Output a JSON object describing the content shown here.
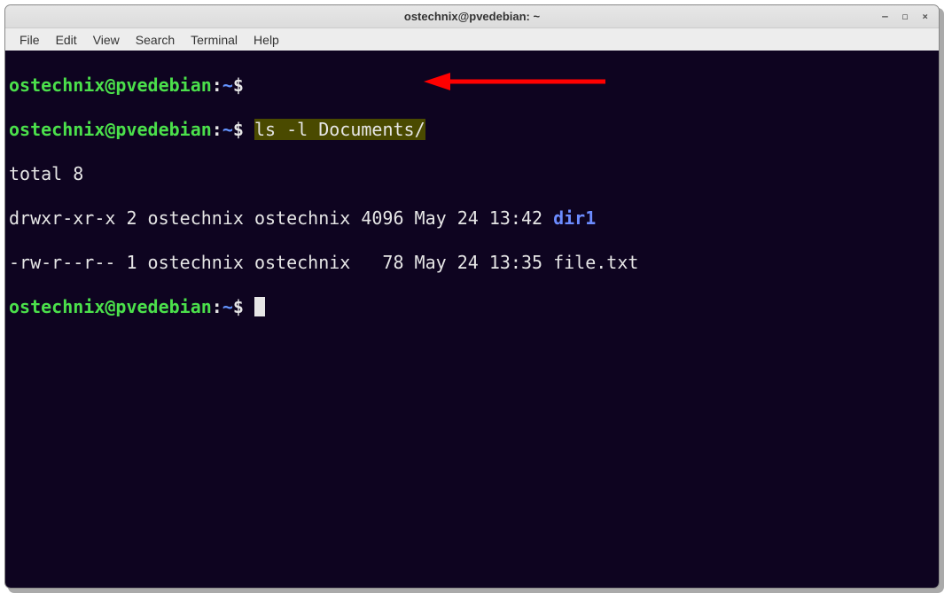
{
  "window": {
    "title": "ostechnix@pvedebian: ~",
    "controls": {
      "minimize": "–",
      "maximize": "◻",
      "close": "×"
    }
  },
  "menubar": [
    "File",
    "Edit",
    "View",
    "Search",
    "Terminal",
    "Help"
  ],
  "prompt": {
    "user_host": "ostechnix@pvedebian",
    "separator": ":",
    "path": "~",
    "dollar": "$"
  },
  "lines": {
    "cmd1": " ",
    "cmd2_hl": "ls -l Documents/",
    "out_total": "total 8",
    "out_row1_a": "drwxr-xr-x 2 ostechnix ostechnix 4096 May 24 13:42 ",
    "out_row1_dir": "dir1",
    "out_row2": "-rw-r--r-- 1 ostechnix ostechnix   78 May 24 13:35 file.txt"
  },
  "listing": [
    {
      "perm": "drwxr-xr-x",
      "links": 2,
      "owner": "ostechnix",
      "group": "ostechnix",
      "size": 4096,
      "date": "May 24 13:42",
      "name": "dir1",
      "is_dir": true
    },
    {
      "perm": "-rw-r--r--",
      "links": 1,
      "owner": "ostechnix",
      "group": "ostechnix",
      "size": 78,
      "date": "May 24 13:35",
      "name": "file.txt",
      "is_dir": false
    }
  ],
  "colors": {
    "term_bg": "#0e0420",
    "prompt_green": "#4be04b",
    "dir_blue": "#6c8cff",
    "highlight_bg": "#4a4a00",
    "arrow_red": "#ff0000"
  }
}
